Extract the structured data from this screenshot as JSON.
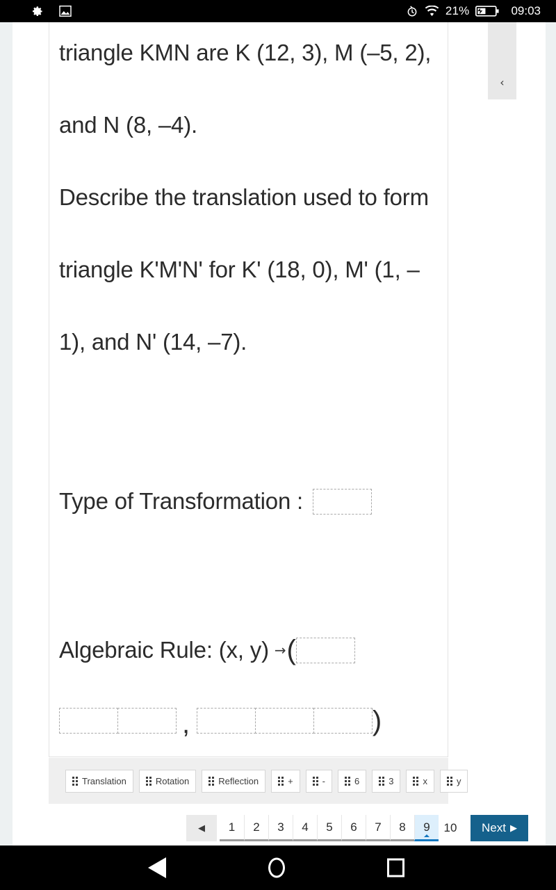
{
  "statusbar": {
    "left_icons": [
      "gear-icon",
      "image-icon"
    ],
    "alarm_icon": "alarm-icon",
    "wifi_icon": "wifi-icon",
    "battery_percent": "21%",
    "battery_icon": "battery-charging-icon",
    "clock": "09:03"
  },
  "panel": {
    "collapse_label": "‹"
  },
  "question": {
    "paragraph1": "triangle KMN are K (12, 3), M (–5, 2), and N (8, –4).",
    "paragraph2": "Describe the translation used to form triangle K'M'N' for K' (18, 0), M' (1, –1), and N' (14, –7).",
    "type_label": "Type of Transformation :",
    "rule_label": "Algebraic Rule: (x, y)",
    "rule_arrow": "→",
    "open_paren": "(",
    "close_paren": ")",
    "comma": ",",
    "type_dropbox_value": "",
    "rule_dropbox_value": "",
    "answer_boxes_group1": [
      "",
      ""
    ],
    "answer_boxes_group2": [
      "",
      "",
      ""
    ]
  },
  "tray": {
    "tokens": [
      {
        "label": "Translation"
      },
      {
        "label": "Rotation"
      },
      {
        "label": "Reflection"
      },
      {
        "label": "+"
      },
      {
        "label": "-"
      },
      {
        "label": "6"
      },
      {
        "label": "3"
      },
      {
        "label": "x"
      },
      {
        "label": "y"
      }
    ]
  },
  "pagination": {
    "prev_label": "◀",
    "pages": [
      "1",
      "2",
      "3",
      "4",
      "5",
      "6",
      "7",
      "8",
      "9",
      "10"
    ],
    "current_page": "9",
    "next_label": "Next",
    "next_arrow": "▶"
  },
  "navbar": {
    "back": "back-icon",
    "home": "home-icon",
    "recents": "recents-icon"
  },
  "colors": {
    "accent_blue": "#15618c",
    "current_page_bg": "#ddeffc",
    "current_page_underline": "#1277c0",
    "tray_bg": "#efefef",
    "strip_bg": "#edf1f2"
  }
}
